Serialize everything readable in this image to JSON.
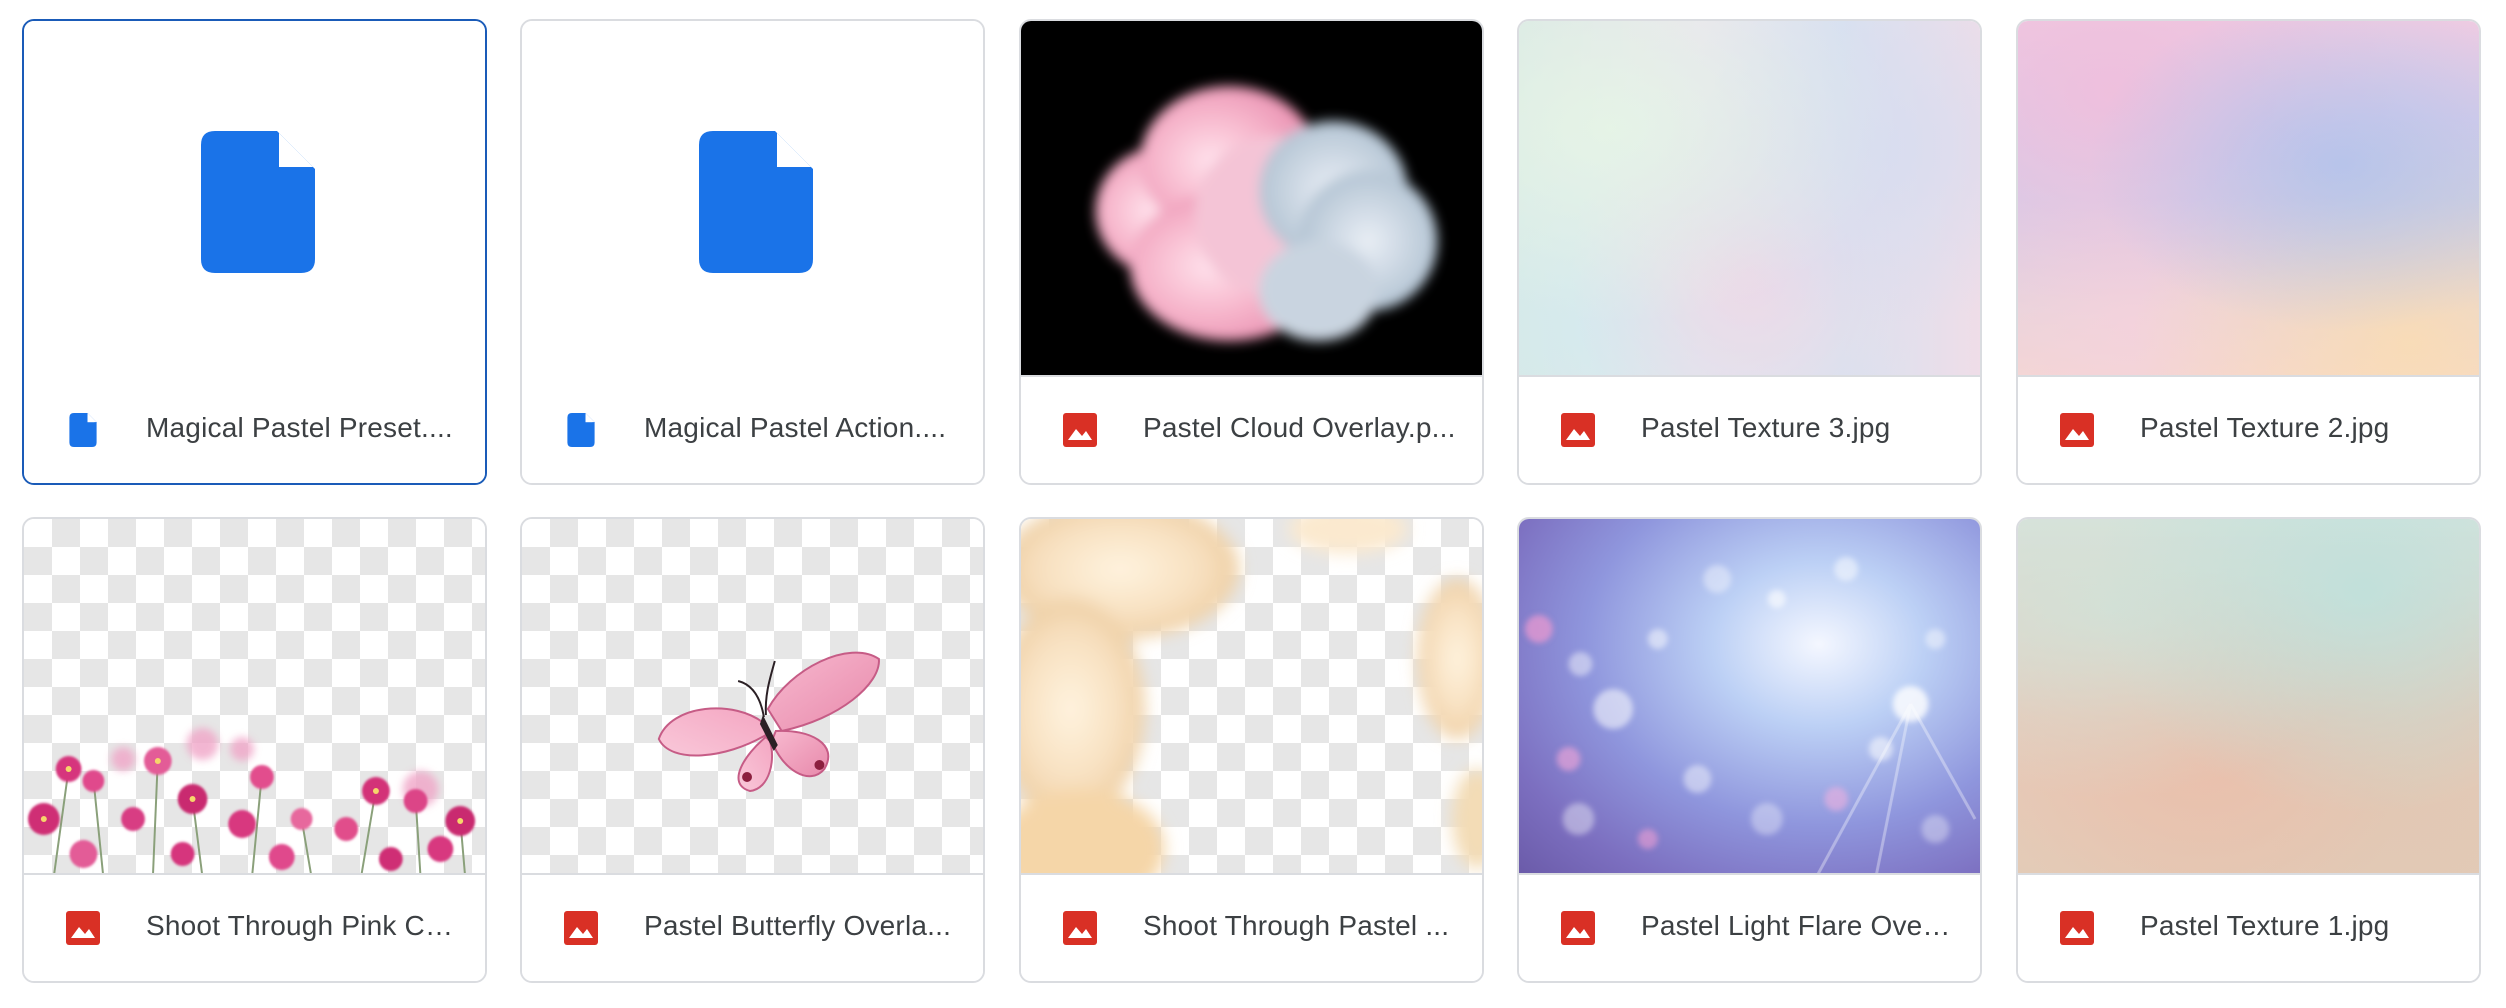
{
  "files": [
    {
      "name": "Magical Pastel Preset....",
      "type": "document",
      "icon": "doc-icon",
      "thumbnail": "document-placeholder",
      "selected": true
    },
    {
      "name": "Magical Pastel Action....",
      "type": "document",
      "icon": "doc-icon",
      "thumbnail": "document-placeholder",
      "selected": false
    },
    {
      "name": "Pastel Cloud Overlay.p...",
      "type": "image",
      "icon": "image-icon",
      "thumbnail": "pink cloud on black",
      "selected": false
    },
    {
      "name": "Pastel Texture 3.jpg",
      "type": "image",
      "icon": "image-icon",
      "thumbnail": "iridescent pastel texture",
      "selected": false
    },
    {
      "name": "Pastel Texture 2.jpg",
      "type": "image",
      "icon": "image-icon",
      "thumbnail": "pink blue peach gradient texture",
      "selected": false
    },
    {
      "name": "Shoot Through Pink Co...",
      "type": "image",
      "icon": "image-icon",
      "thumbnail": "pink cosmos flowers on transparency",
      "selected": false
    },
    {
      "name": "Pastel Butterfly Overla...",
      "type": "image",
      "icon": "image-icon",
      "thumbnail": "pink butterfly on transparency",
      "selected": false
    },
    {
      "name": "Shoot Through Pastel ...",
      "type": "image",
      "icon": "image-icon",
      "thumbnail": "cream roses on transparency",
      "selected": false
    },
    {
      "name": "Pastel Light Flare Over...",
      "type": "image",
      "icon": "image-icon",
      "thumbnail": "blue purple bokeh flare",
      "selected": false
    },
    {
      "name": "Pastel Texture 1.jpg",
      "type": "image",
      "icon": "image-icon",
      "thumbnail": "peach teal grunge texture",
      "selected": false
    }
  ],
  "colors": {
    "doc_icon": "#1a73e8",
    "image_icon": "#d93025",
    "selected_border": "#1a5bb8",
    "card_border": "#dadce0",
    "text": "#3c4043"
  }
}
